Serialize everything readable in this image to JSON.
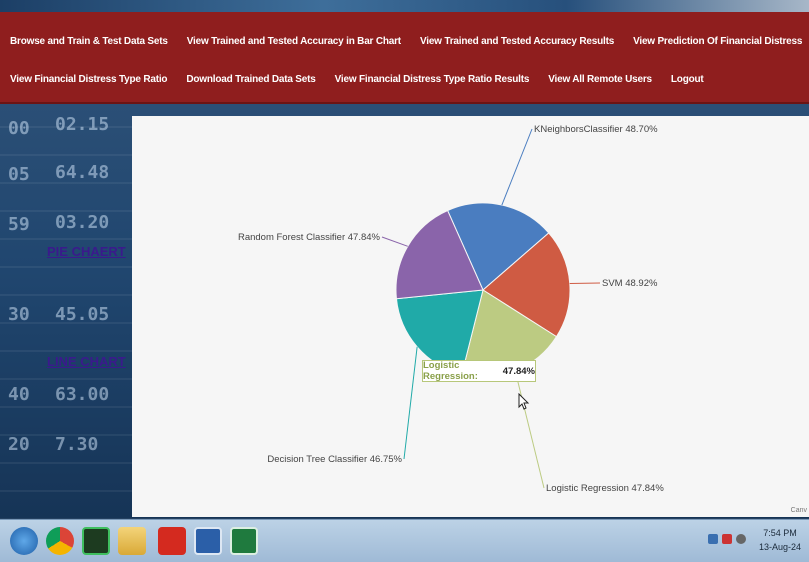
{
  "nav": {
    "row1": [
      "Browse and Train & Test Data Sets",
      "View Trained and Tested Accuracy in Bar Chart",
      "View Trained and Tested Accuracy Results",
      "View Prediction Of Financial Distress"
    ],
    "row2": [
      "View Financial Distress Type Ratio",
      "Download Trained Data Sets",
      "View Financial Distress Type Ratio Results",
      "View All Remote Users",
      "Logout"
    ]
  },
  "sidebar": {
    "pie_link": "PIE CHAERT",
    "line_link": "LINE CHART"
  },
  "chart_data": {
    "type": "pie",
    "slices": [
      {
        "label": "KNeighborsClassifier",
        "value": 48.7,
        "text": "KNeighborsClassifier 48.70%",
        "color": "#4a7dc0"
      },
      {
        "label": "SVM",
        "value": 48.92,
        "text": "SVM 48.92%",
        "color": "#cf5b43"
      },
      {
        "label": "Logistic Regression",
        "value": 47.84,
        "text": "Logistic Regression 47.84%",
        "color": "#bccb82"
      },
      {
        "label": "Decision Tree Classifier",
        "value": 46.75,
        "text": "Decision Tree Classifier 46.75%",
        "color": "#20aaa8"
      },
      {
        "label": "Random Forest Classifier",
        "value": 47.84,
        "text": "Random Forest Classifier 47.84%",
        "color": "#8a64aa"
      }
    ],
    "tooltip": {
      "name": "Logistic Regression:",
      "value": "47.84%"
    },
    "credit": "Canv"
  },
  "taskbar": {
    "time": "7:54 PM",
    "date": "13-Aug-24",
    "icons": [
      "windows-start-icon",
      "chrome-icon",
      "pycharm-icon",
      "file-explorer-icon",
      "pdf-reader-icon",
      "app-window-icon",
      "excel-icon"
    ]
  }
}
